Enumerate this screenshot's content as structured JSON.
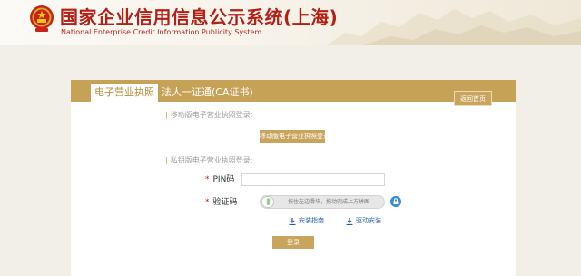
{
  "header": {
    "title_cn": "国家企业信用信息公示系统(上海)",
    "title_en": "National Enterprise Credit Information Publicity System"
  },
  "tabs": {
    "active": "电子营业执照",
    "ca": "法人一证通(CA证书)",
    "back": "返回首页"
  },
  "mobile_section": {
    "title": "移动版电子营业执照登录:",
    "button": "移动版电子营业执照登录"
  },
  "private_section": {
    "title": "私钥版电子营业执照登录:",
    "pin_label": "PIN码",
    "captcha_label": "验证码",
    "slider_text": "按住左边滑块，拖动完成上方拼图",
    "install_guide": "安装指南",
    "driver_install": "驱动安装",
    "login": "登录"
  },
  "colors": {
    "gold": "#c6a257",
    "title_red": "#b22016",
    "link_blue": "#1f5fa8"
  }
}
